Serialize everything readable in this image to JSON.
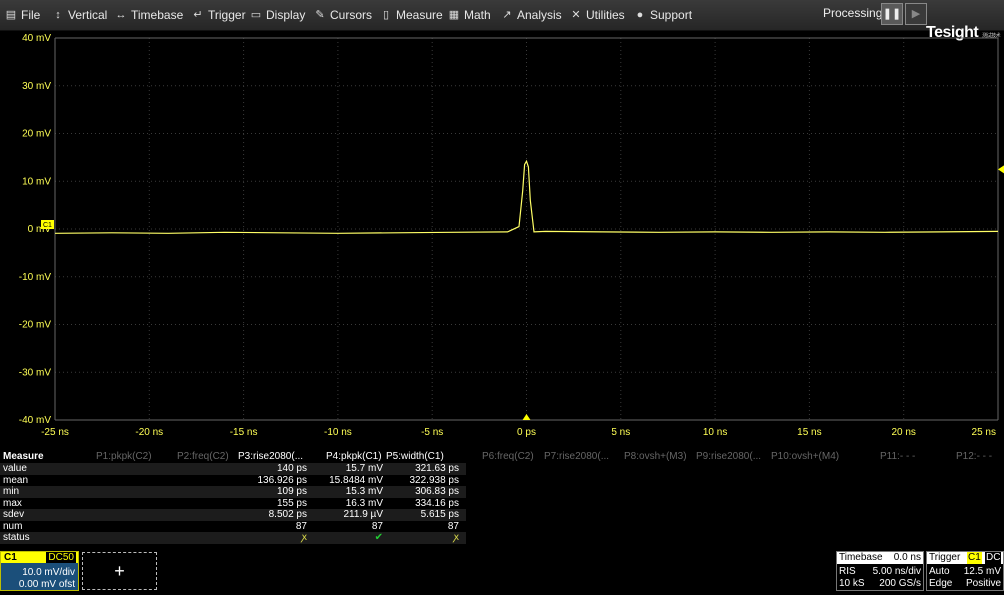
{
  "menu": {
    "items": [
      {
        "label": "File",
        "icon": "file-icon",
        "glyph": "▤"
      },
      {
        "label": "Vertical",
        "icon": "vertical-arrows-icon",
        "glyph": "↕"
      },
      {
        "label": "Timebase",
        "icon": "horizontal-arrows-icon",
        "glyph": "↔"
      },
      {
        "label": "Trigger",
        "icon": "trigger-icon",
        "glyph": "↵"
      },
      {
        "label": "Display",
        "icon": "display-icon",
        "glyph": "▭"
      },
      {
        "label": "Cursors",
        "icon": "cursors-icon",
        "glyph": "✎"
      },
      {
        "label": "Measure",
        "icon": "measure-icon",
        "glyph": "▯"
      },
      {
        "label": "Math",
        "icon": "math-icon",
        "glyph": "▦"
      },
      {
        "label": "Analysis",
        "icon": "analysis-icon",
        "glyph": "↗"
      },
      {
        "label": "Utilities",
        "icon": "utilities-icon",
        "glyph": "✕"
      },
      {
        "label": "Support",
        "icon": "support-icon",
        "glyph": "●"
      }
    ],
    "processing_label": "Processing:",
    "pause_glyph": "❚❚",
    "run_glyph": "▶"
  },
  "logo": {
    "text": "Tesight",
    "sub": "测试技术"
  },
  "graticule": {
    "y_labels": [
      "40 mV",
      "30 mV",
      "20 mV",
      "10 mV",
      "0 mV",
      "-10 mV",
      "-20 mV",
      "-30 mV",
      "-40 mV"
    ],
    "x_labels": [
      "-25 ns",
      "-20 ns",
      "-15 ns",
      "-10 ns",
      "-5 ns",
      "0 ps",
      "5 ns",
      "10 ns",
      "15 ns",
      "20 ns",
      "25 ns"
    ],
    "channel_marker": "C1"
  },
  "chart_data": {
    "type": "line",
    "series": [
      {
        "name": "C1",
        "color": "#ffff66",
        "x": [
          -25,
          -22,
          -19,
          -16,
          -13,
          -10,
          -7,
          -4,
          -1,
          -0.4,
          -0.2,
          -0.1,
          0,
          0.1,
          0.2,
          0.4,
          1,
          4,
          7,
          10,
          13,
          16,
          19,
          22,
          25
        ],
        "values": [
          -0.9,
          -0.8,
          -0.9,
          -0.7,
          -0.8,
          -0.9,
          -0.8,
          -0.7,
          -0.6,
          0.5,
          8,
          13.5,
          14.2,
          13,
          6,
          -0.6,
          -0.5,
          -0.6,
          -0.7,
          -0.6,
          -0.7,
          -0.6,
          -0.7,
          -0.6,
          -0.5
        ]
      }
    ],
    "xlim": [
      -25,
      25
    ],
    "ylim": [
      -40,
      40
    ],
    "xlabel": "",
    "ylabel": "",
    "grid": true
  },
  "measure": {
    "title": "Measure",
    "headers": [
      {
        "label": "P1:pkpk(C2)",
        "active": false
      },
      {
        "label": "P2:freq(C2)",
        "active": false
      },
      {
        "label": "P3:rise2080(...",
        "active": true
      },
      {
        "label": "P4:pkpk(C1)",
        "active": true
      },
      {
        "label": "P5:width(C1)",
        "active": true
      },
      {
        "label": "P6:freq(C2)",
        "active": false
      },
      {
        "label": "P7:rise2080(...",
        "active": false
      },
      {
        "label": "P8:ovsh+(M3)",
        "active": false
      },
      {
        "label": "P9:rise2080(...",
        "active": false
      },
      {
        "label": "P10:ovsh+(M4)",
        "active": false
      },
      {
        "label": "P11:- - -",
        "active": false
      },
      {
        "label": "P12:- - -",
        "active": false
      }
    ],
    "rows": [
      {
        "label": "value",
        "p3": "140 ps",
        "p4": "15.7 mV",
        "p5": "321.63 ps"
      },
      {
        "label": "mean",
        "p3": "136.926 ps",
        "p4": "15.8484 mV",
        "p5": "322.938 ps"
      },
      {
        "label": "min",
        "p3": "109 ps",
        "p4": "15.3 mV",
        "p5": "306.83 ps"
      },
      {
        "label": "max",
        "p3": "155 ps",
        "p4": "16.3 mV",
        "p5": "334.16 ps"
      },
      {
        "label": "sdev",
        "p3": "8.502 ps",
        "p4": "211.9 µV",
        "p5": "5.615 ps"
      },
      {
        "label": "num",
        "p3": "87",
        "p4": "87",
        "p5": "87"
      },
      {
        "label": "status",
        "p3": "ꭗ",
        "p4": "✔",
        "p5": "ꭗ"
      }
    ],
    "status_colors": {
      "warn": "#d8d84a",
      "ok": "#22cc33"
    }
  },
  "channel": {
    "name": "C1",
    "coupling": "DC50",
    "vdiv": "10.0 mV/div",
    "offset": "0.00 mV ofst"
  },
  "add_button": "+",
  "timebase": {
    "label": "Timebase",
    "delay": "0.0 ns",
    "mode": "RIS",
    "tdiv": "5.00 ns/div",
    "samples": "10 kS",
    "rate": "200 GS/s"
  },
  "trigger": {
    "label": "Trigger",
    "source": "C1",
    "coupling": "DC",
    "mode": "Auto",
    "level": "12.5 mV",
    "type": "Edge",
    "slope": "Positive"
  }
}
